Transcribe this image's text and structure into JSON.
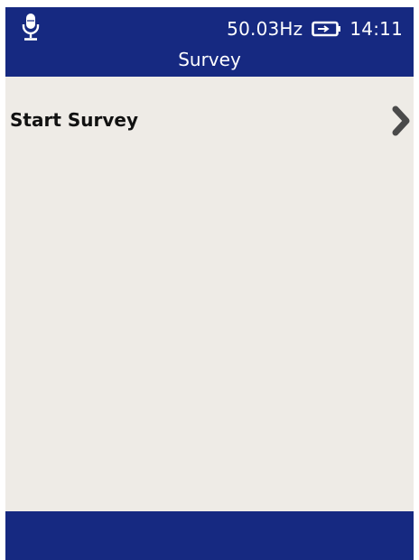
{
  "status_bar": {
    "mic_icon": "microphone-icon",
    "frequency": "50.03Hz",
    "battery_icon": "battery-charging-icon",
    "time": "14:11"
  },
  "header": {
    "title": "Survey"
  },
  "menu": {
    "items": [
      {
        "label": "Start Survey",
        "icon": "chevron-right-icon"
      }
    ]
  },
  "colors": {
    "header_bg": "#162981",
    "content_bg": "#eeebe6",
    "footer_bg": "#162981",
    "chevron": "#4a4a4a"
  }
}
